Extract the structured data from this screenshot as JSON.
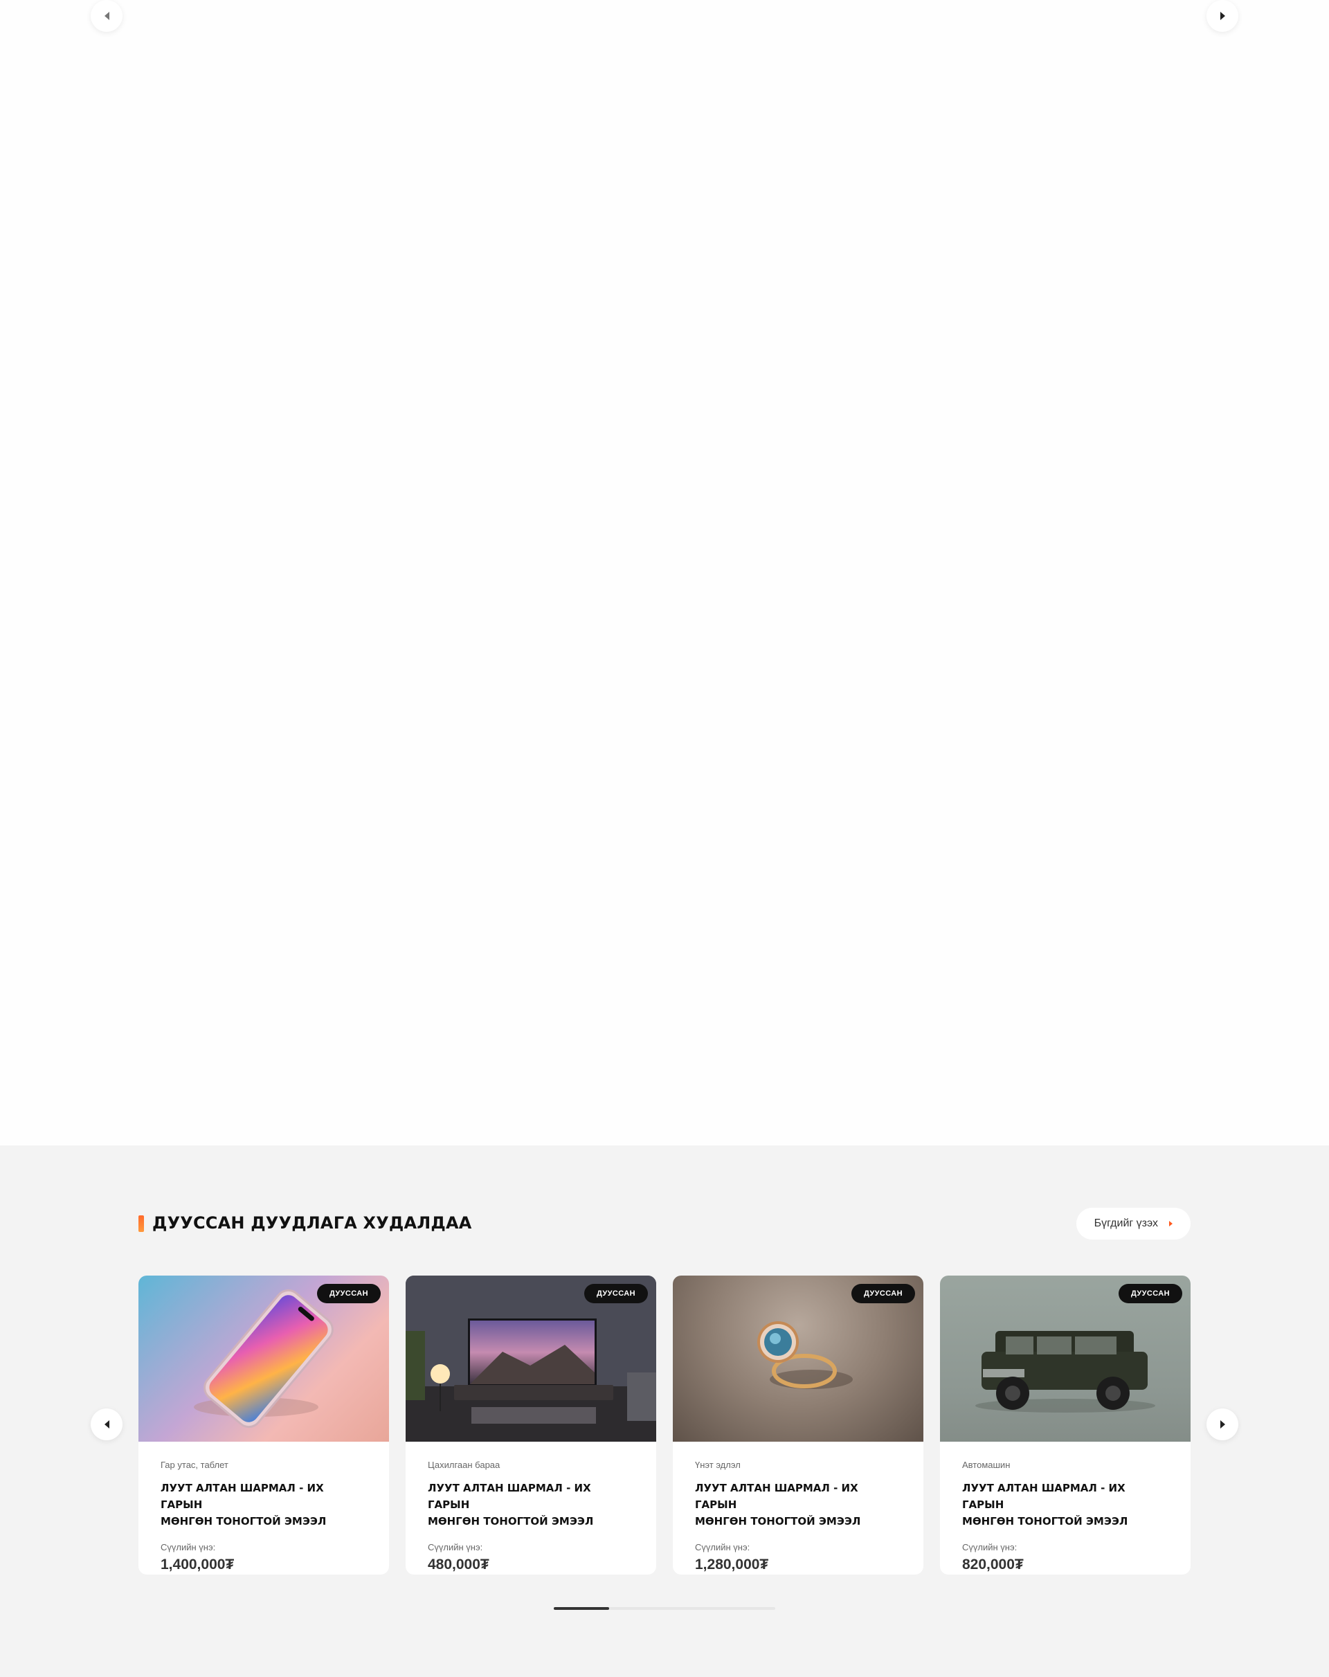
{
  "top_slider": {
    "prev_label": "",
    "next_label": ""
  },
  "ended_section": {
    "title": "ДУУССАН ДУУДЛАГА ХУДАЛДАА",
    "view_all_label": "Бүгдийг үзэх",
    "progress": 0.25,
    "cards": [
      {
        "badge": "ДУУССАН",
        "category": "Гар утас, таблет",
        "title_line1": "ЛУУТ АЛТАН ШАРМАЛ - ИХ ГАРЫН",
        "title_line2": "МӨНГӨН ТОНОГТОЙ ЭМЭЭЛ",
        "price_label": "Сүүлийн үнэ:",
        "price": "1,400,000₮",
        "image": "smartphone-photo"
      },
      {
        "badge": "ДУУССАН",
        "category": "Цахилгаан бараа",
        "title_line1": "ЛУУТ АЛТАН ШАРМАЛ - ИХ ГАРЫН",
        "title_line2": "МӨНГӨН ТОНОГТОЙ ЭМЭЭЛ",
        "price_label": "Сүүлийн үнэ:",
        "price": "480,000₮",
        "image": "tv-livingroom-photo"
      },
      {
        "badge": "ДУУССАН",
        "category": "Үнэт эдлэл",
        "title_line1": "ЛУУТ АЛТАН ШАРМАЛ - ИХ ГАРЫН",
        "title_line2": "МӨНГӨН ТОНОГТОЙ ЭМЭЭЛ",
        "price_label": "Сүүлийн үнэ:",
        "price": "1,280,000₮",
        "image": "ring-photo"
      },
      {
        "badge": "ДУУССАН",
        "category": "Автомашин",
        "title_line1": "ЛУУТ АЛТАН ШАРМАЛ - ИХ ГАРЫН",
        "title_line2": "МӨНГӨН ТОНОГТОЙ ЭМЭЭЛ",
        "price_label": "Сүүлийн үнэ:",
        "price": "820,000₮",
        "image": "suv-photo"
      }
    ]
  },
  "colors": {
    "accent": "#ff5a1f",
    "badge_bg": "#111111",
    "section_bg": "#f3f3f3"
  }
}
